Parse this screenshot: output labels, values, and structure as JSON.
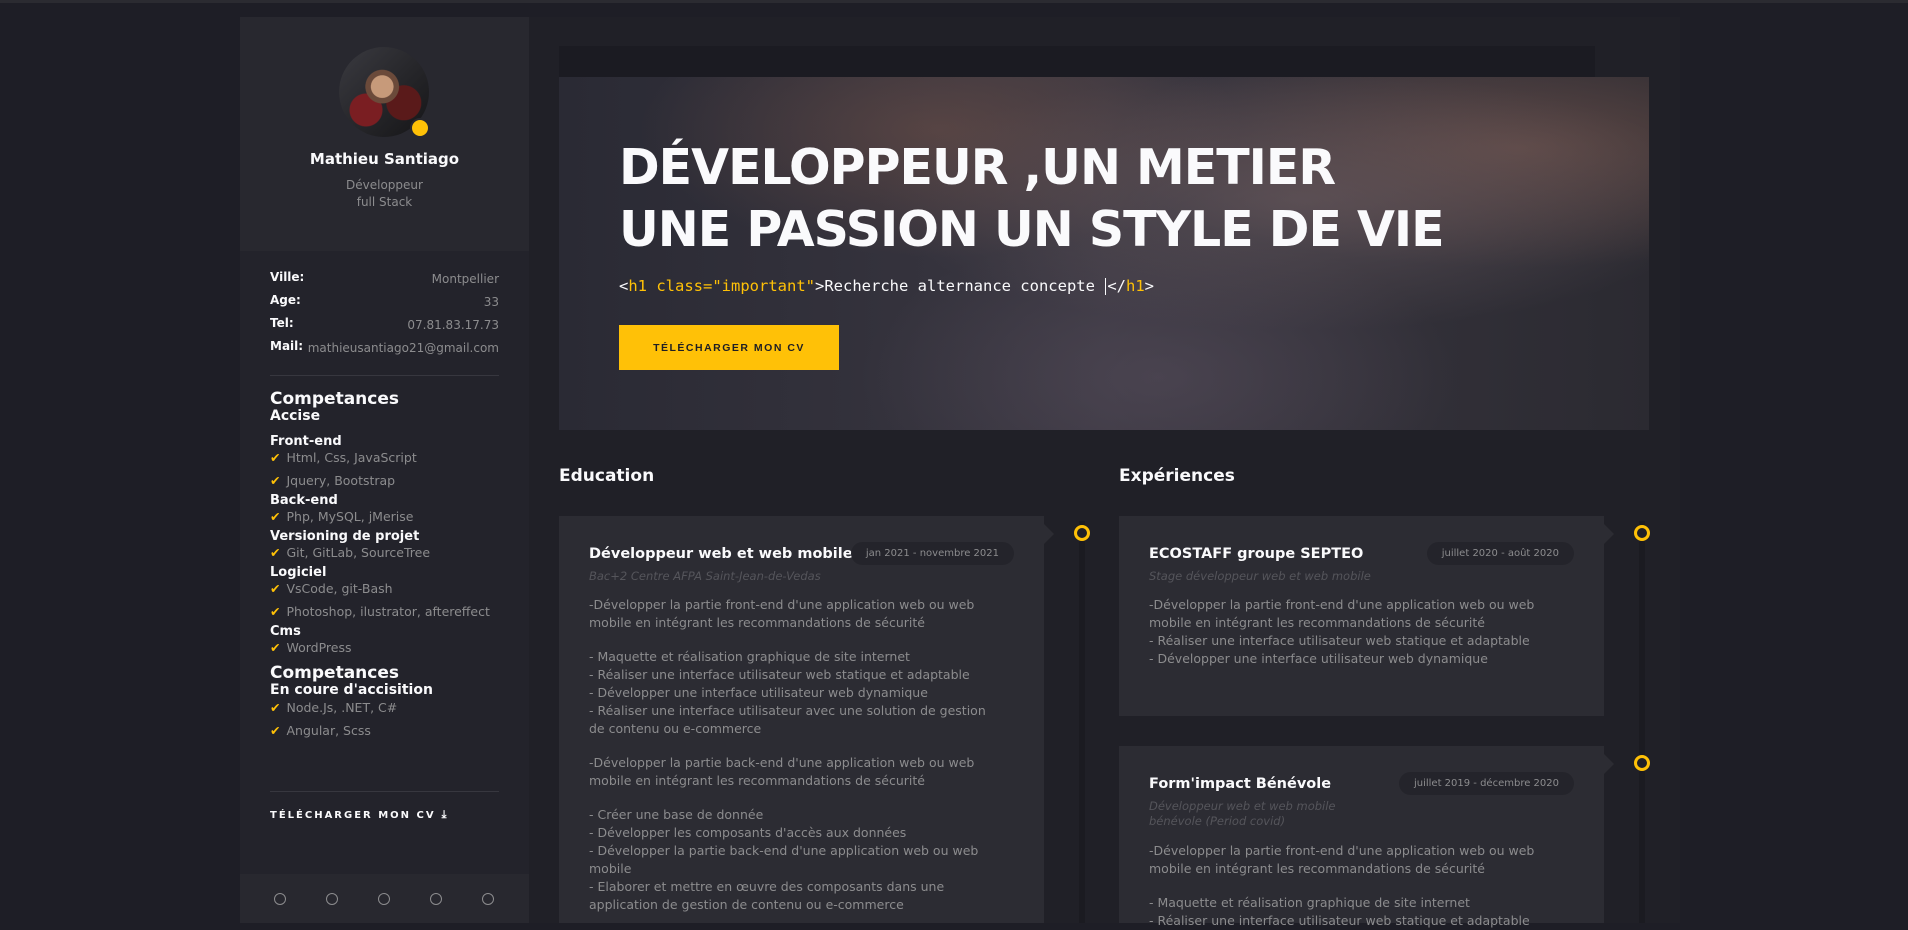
{
  "profile": {
    "name": "Mathieu Santiago",
    "role_line1": "Développeur",
    "role_line2": "full Stack",
    "colors": {
      "accent": "#ffc107",
      "sidebar": "#23232b",
      "background": "#1e1e26"
    }
  },
  "info": [
    {
      "label": "Ville:",
      "value": "Montpellier"
    },
    {
      "label": "Age:",
      "value": "33"
    },
    {
      "label": "Tel:",
      "value": "07.81.83.17.73"
    },
    {
      "label": "Mail:",
      "value": "mathieusantiago21@gmail.com"
    }
  ],
  "skills": {
    "heading1": "Competances",
    "sub1": "Accise",
    "categories": [
      {
        "name": "Front-end",
        "items": [
          "Html, Css, JavaScript",
          "Jquery, Bootstrap"
        ]
      },
      {
        "name": "Back-end",
        "items": [
          "Php, MySQL, jMerise"
        ]
      },
      {
        "name": "Versioning de projet",
        "items": [
          "Git, GitLab, SourceTree"
        ]
      },
      {
        "name": "Logiciel",
        "items": [
          "VsCode, git-Bash",
          "Photoshop, ilustrator, aftereffect"
        ]
      },
      {
        "name": "Cms",
        "items": [
          "WordPress"
        ]
      }
    ],
    "heading2": "Competances",
    "sub2": "En coure d'accisition",
    "learning": [
      "Node.Js, .NET, C#",
      "Angular, Scss"
    ]
  },
  "sidebar_download": "TÉLÉCHARGER MON CV",
  "social_icons": [
    "circle-icon",
    "circle-icon",
    "circle-icon",
    "circle-icon",
    "circle-icon"
  ],
  "hero": {
    "title_line1": "DÉVELOPPEUR ,UN METIER",
    "title_line2": "UNE PASSION UN STYLE DE VIE",
    "code_open_bracket": "<",
    "code_tag": "h1",
    "code_attr": " class=\"important\"",
    "code_close": ">",
    "code_text": "Recherche alternance concepte ",
    "code_end_open": "</",
    "code_end_tag": "h1",
    "code_end_close": ">",
    "button": "TÉLÉCHARGER MON CV"
  },
  "education": {
    "title": "Education",
    "items": [
      {
        "title": "Développeur web et web mobile",
        "date": "jan 2021 - novembre 2021",
        "sub": "Bac+2 Centre AFPA Saint-Jean-de-Vedas",
        "lines": [
          "-Développer la partie front-end d'une application web ou web",
          "mobile en intégrant les recommandations de sécurité",
          "",
          "- Maquette et réalisation graphique de site internet",
          "- Réaliser une interface utilisateur web statique et adaptable",
          "- Développer une interface utilisateur web dynamique",
          "- Réaliser une interface utilisateur avec une solution de gestion",
          "de contenu ou e-commerce",
          "",
          "-Développer la partie back-end d'une application web ou web",
          "mobile en intégrant les recommandations de sécurité",
          "",
          "- Créer une base de donnée",
          "- Développer les composants d'accès aux données",
          "- Développer la partie back-end d'une application web ou web",
          "mobile",
          "- Elaborer et mettre en œuvre des composants dans une",
          "application de gestion de contenu ou e-commerce"
        ]
      }
    ]
  },
  "experience": {
    "title": "Expériences",
    "items": [
      {
        "title": "ECOSTAFF groupe SEPTEO",
        "date": "juillet 2020 - août 2020",
        "sub_line1": "Stage développeur web et web mobile",
        "sub_line2": "",
        "lines": [
          "-Développer la partie front-end d'une application web ou web",
          "mobile en intégrant les recommandations de sécurité",
          "- Réaliser une interface utilisateur web statique et adaptable",
          "- Développer une interface utilisateur web dynamique"
        ]
      },
      {
        "title": "Form'impact Bénévole",
        "date": "juillet 2019 - décembre 2020",
        "sub_line1": "Développeur web et web mobile",
        "sub_line2": "bénévole (Period covid)",
        "lines": [
          "-Développer la partie front-end d'une application web ou web",
          "mobile en intégrant les recommandations de sécurité",
          "",
          "- Maquette et réalisation graphique de site internet",
          "- Réaliser une interface utilisateur web statique et adaptable"
        ]
      }
    ]
  }
}
